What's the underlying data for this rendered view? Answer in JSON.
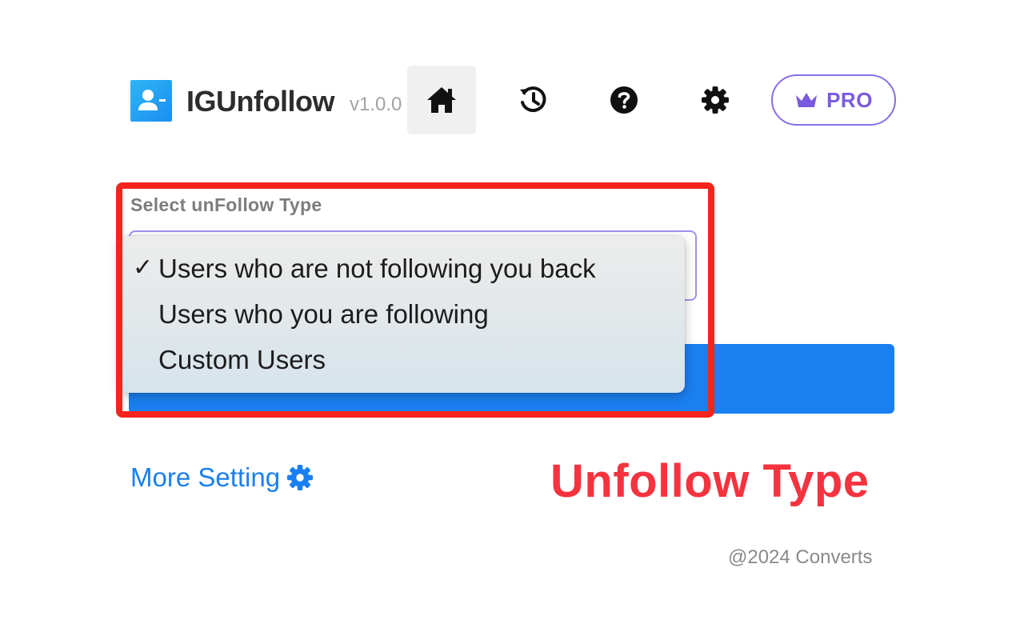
{
  "header": {
    "app_name": "IGUnfollow",
    "version": "v1.0.0",
    "nav": [
      {
        "name": "home",
        "icon": "home-icon",
        "active": true
      },
      {
        "name": "history",
        "icon": "history-icon",
        "active": false
      },
      {
        "name": "help",
        "icon": "help-icon",
        "active": false
      },
      {
        "name": "settings",
        "icon": "gear-icon",
        "active": false
      }
    ],
    "pro_label": "PRO",
    "pro_icon": "crown-icon"
  },
  "form": {
    "label": "Select unFollow Type",
    "dropdown": {
      "options": [
        "Users who are not following you back",
        "Users who you are following",
        "Custom Users"
      ],
      "selected": "Users who are not following you back"
    }
  },
  "more_setting": {
    "label": "More Setting",
    "icon": "gear-icon"
  },
  "annotation": "Unfollow Type",
  "footer": "@2024 Converts",
  "colors": {
    "primary": "#1a7ff0",
    "pro": "#7a5ae0",
    "annotation": "#f5333f",
    "highlight_frame": "#f5241c"
  }
}
